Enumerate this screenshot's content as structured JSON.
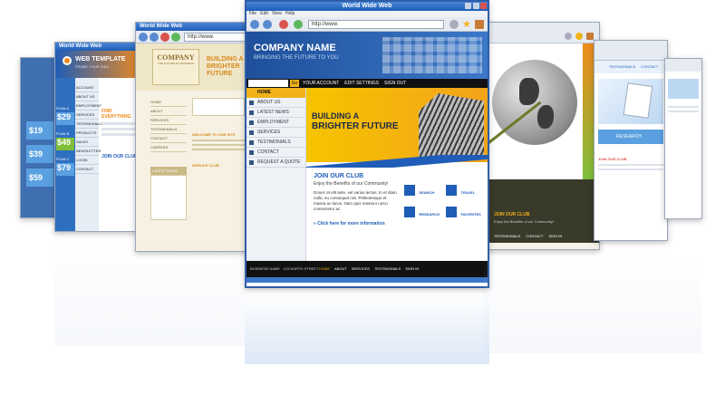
{
  "main_window": {
    "title": "World Wide Web",
    "menu": [
      "File",
      "Edit",
      "View",
      "Help"
    ],
    "address": "http://www.",
    "company_name": "COMPANY NAME",
    "tagline": "BRINGING THE FUTURE TO YOU",
    "topnav": [
      "ABOUT US",
      "LATEST NEWS",
      "EMPLOYMENT",
      "SERVICES",
      "TESTIMONIALS",
      "CONTACT",
      "REQUEST A QUOTE"
    ],
    "top_links": [
      "YOUR ACCOUNT",
      "EDIT SETTINGS",
      "SIGN OUT"
    ],
    "go_label": "Go",
    "home_label": "HOME",
    "hero_line1": "BUILDING A",
    "hero_line2": "BRIGHTER FUTURE",
    "club_title": "JOIN OUR CLUB",
    "club_sub": "Enjoy the Benefits of our Community!",
    "club_body": "Donec et elit ante, vel varius lectus. In et diam nulla, eu consequat nisi. Pellentesque et massa ac lacus. Nam quis massa in arcu consectetur ac.",
    "club_link": "» Click here for more information",
    "features": [
      "SEARCH",
      "TRAVEL",
      "RESEARCH",
      "FAVORITES"
    ],
    "footer_business": "BUSINESS NAME · 123 NORTH STREET",
    "footer_links": [
      "HOME",
      "ABOUT",
      "SERVICES",
      "TESTIMONIALS",
      "SIGN IN"
    ]
  },
  "left_window": {
    "title": "World Wide Web",
    "address": "http://www.",
    "company": "COMPANY",
    "company_sub": "THE FUTURE OF BUSINESS",
    "heading": "BUILDING A BRIGHTER FUTURE",
    "nav": [
      "HOME",
      "ABOUT",
      "SERVICES",
      "TESTIMONIALS",
      "CONTACT",
      "CAREERS"
    ],
    "latest_news": "LATEST NEWS",
    "welcome": "WELCOME TO OUR SITE",
    "service_club": "SERVICE CLUB"
  },
  "far_left_window": {
    "title": "World Wide Web",
    "brand": "WEB TEMPLATE",
    "brand_sub": "FRAME YOUR IDEA",
    "find": "FIND EVERYTHING",
    "nav": [
      "ACCOUNT",
      "ABOUT US",
      "EMPLOYMENT",
      "SERVICES",
      "TESTIMONIALS",
      "PRODUCTS",
      "SALES",
      "NEWSLETTER",
      "LOGIN",
      "CONTACT"
    ],
    "join": "JOIN OUR CLUB",
    "plans": [
      "PLAN A",
      "PLAN B",
      "PLAN C"
    ],
    "prices": [
      "$29",
      "$49",
      "$79"
    ],
    "sidebar_prices": [
      "$19",
      "$39",
      "$59"
    ]
  },
  "right_window": {
    "join": "JOIN OUR CLUB",
    "join_sub": "Enjoy the Benefits of our Community!",
    "footer": [
      "TESTIMONIALS",
      "CONTACT",
      "SIGN IN"
    ]
  },
  "far_right_window": {
    "nav": [
      "TESTIMONIALS",
      "CONTACT"
    ],
    "research": "RESEARCH",
    "join": "JOIN OUR CLUB"
  },
  "colors": {
    "brand_blue": "#1f5db8",
    "hero_yellow": "#f2b21a",
    "orange": "#f08a1c",
    "green": "#7fbf3a"
  }
}
